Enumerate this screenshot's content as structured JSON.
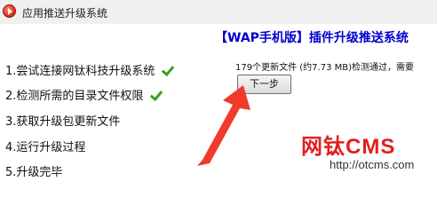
{
  "window": {
    "title": "应用推送升级系统",
    "icon": "app-logo-icon"
  },
  "product_title": "【WAP手机版】插件升级推送系统",
  "steps": [
    {
      "label": "1.尝试连接网钛科技升级系统",
      "done": true
    },
    {
      "label": "2.检测所需的目录文件权限",
      "done": true
    },
    {
      "label": "3.获取升级包更新文件",
      "done": false
    },
    {
      "label": "4.运行升级过程",
      "done": false
    },
    {
      "label": "5.升级完毕",
      "done": false
    }
  ],
  "status_text": "179个更新文件 (约7.73 MB)检测通过，需要",
  "next_button": "下一步",
  "watermark": {
    "brand": "网钛CMS",
    "url": "http://otcms.com"
  },
  "colors": {
    "product_title": "#0000cc",
    "checkmark": "#3e9e1f",
    "arrow": "#f03a2a",
    "watermark": "#e02020"
  }
}
